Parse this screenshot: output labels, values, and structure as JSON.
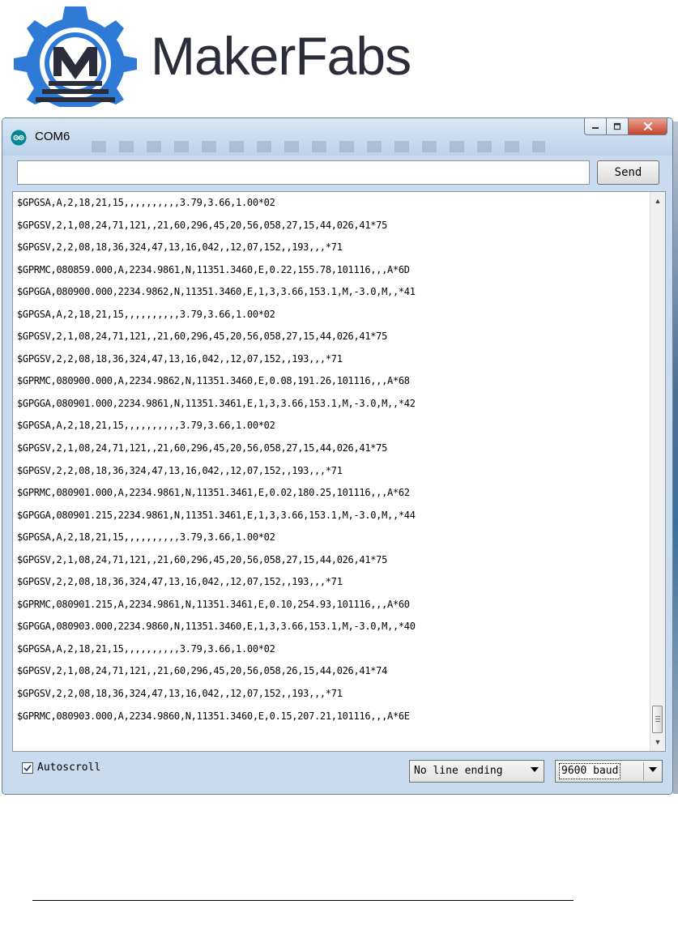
{
  "logo": {
    "brand_text": "MakerFabs",
    "monogram": "M"
  },
  "window": {
    "title": "COM6",
    "app_icon": "arduino-infinity-icon",
    "controls": [
      "minimize-icon",
      "maximize-icon",
      "close-icon"
    ]
  },
  "input": {
    "value": "",
    "send_label": "Send"
  },
  "output": {
    "lines": [
      "$GPGSA,A,2,18,21,15,,,,,,,,,,3.79,3.66,1.00*02",
      "$GPGSV,2,1,08,24,71,121,,21,60,296,45,20,56,058,27,15,44,026,41*75",
      "$GPGSV,2,2,08,18,36,324,47,13,16,042,,12,07,152,,193,,,*71",
      "$GPRMC,080859.000,A,2234.9861,N,11351.3460,E,0.22,155.78,101116,,,A*6D",
      "$GPGGA,080900.000,2234.9862,N,11351.3460,E,1,3,3.66,153.1,M,-3.0,M,,*41",
      "$GPGSA,A,2,18,21,15,,,,,,,,,,3.79,3.66,1.00*02",
      "$GPGSV,2,1,08,24,71,121,,21,60,296,45,20,56,058,27,15,44,026,41*75",
      "$GPGSV,2,2,08,18,36,324,47,13,16,042,,12,07,152,,193,,,*71",
      "$GPRMC,080900.000,A,2234.9862,N,11351.3460,E,0.08,191.26,101116,,,A*68",
      "$GPGGA,080901.000,2234.9861,N,11351.3461,E,1,3,3.66,153.1,M,-3.0,M,,*42",
      "$GPGSA,A,2,18,21,15,,,,,,,,,,3.79,3.66,1.00*02",
      "$GPGSV,2,1,08,24,71,121,,21,60,296,45,20,56,058,27,15,44,026,41*75",
      "$GPGSV,2,2,08,18,36,324,47,13,16,042,,12,07,152,,193,,,*71",
      "$GPRMC,080901.000,A,2234.9861,N,11351.3461,E,0.02,180.25,101116,,,A*62",
      "$GPGGA,080901.215,2234.9861,N,11351.3461,E,1,3,3.66,153.1,M,-3.0,M,,*44",
      "$GPGSA,A,2,18,21,15,,,,,,,,,,3.79,3.66,1.00*02",
      "$GPGSV,2,1,08,24,71,121,,21,60,296,45,20,56,058,27,15,44,026,41*75",
      "$GPGSV,2,2,08,18,36,324,47,13,16,042,,12,07,152,,193,,,*71",
      "$GPRMC,080901.215,A,2234.9861,N,11351.3461,E,0.10,254.93,101116,,,A*60",
      "$GPGGA,080903.000,2234.9860,N,11351.3460,E,1,3,3.66,153.1,M,-3.0,M,,*40",
      "$GPGSA,A,2,18,21,15,,,,,,,,,,3.79,3.66,1.00*02",
      "$GPGSV,2,1,08,24,71,121,,21,60,296,45,20,56,058,26,15,44,026,41*74",
      "$GPGSV,2,2,08,18,36,324,47,13,16,042,,12,07,152,,193,,,*71",
      "$GPRMC,080903.000,A,2234.9860,N,11351.3460,E,0.15,207.21,101116,,,A*6E"
    ]
  },
  "footer": {
    "autoscroll_label": "Autoscroll",
    "autoscroll_checked": true,
    "line_ending": "No line ending",
    "baud": "9600 baud"
  },
  "colors": {
    "brand_blue": "#2f7ad6",
    "brand_text": "#2b2d3b",
    "titlebar": "#c9dbee"
  }
}
